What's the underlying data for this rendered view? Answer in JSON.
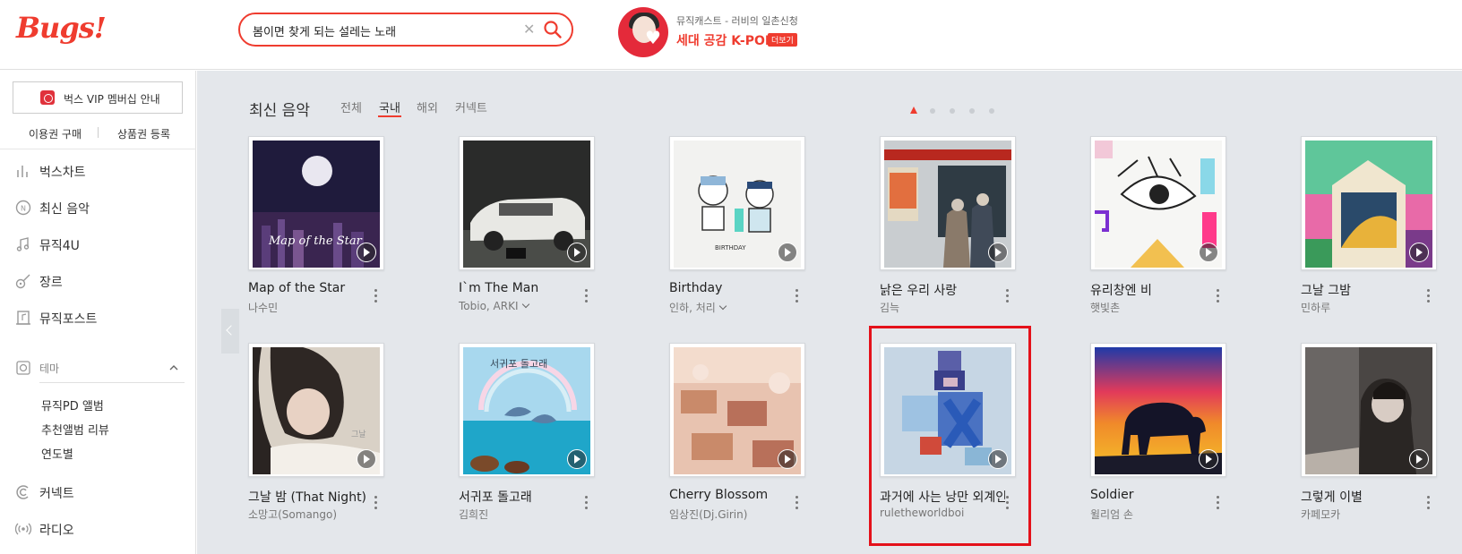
{
  "header": {
    "logo": "Bugs!",
    "search": {
      "value": "봄이면 찾게 되는 설레는 노래",
      "placeholder": ""
    },
    "promo": {
      "subtitle": "뮤직캐스트 - 러비의 일촌신청",
      "title": "세대 공감 K-POP",
      "more_label": "더보기"
    }
  },
  "sidebar": {
    "vip_label": "벅스 VIP 멤버십 안내",
    "buy_pass": "이용권 구매",
    "register_voucher": "상품권 등록",
    "nav": [
      {
        "label": "벅스차트",
        "icon": "chart-icon"
      },
      {
        "label": "최신 음악",
        "icon": "new-music-icon"
      },
      {
        "label": "뮤직4U",
        "icon": "music-note-icon"
      },
      {
        "label": "장르",
        "icon": "guitar-icon"
      },
      {
        "label": "뮤직포스트",
        "icon": "music-post-icon"
      }
    ],
    "theme": {
      "label": "테마",
      "items": [
        "뮤직PD 앨범",
        "추천앨범 리뷰",
        "연도별"
      ]
    },
    "nav_bottom": [
      {
        "label": "커넥트",
        "icon": "connect-icon"
      },
      {
        "label": "라디오",
        "icon": "radio-icon"
      }
    ]
  },
  "main": {
    "section_title": "최신 음악",
    "tabs": [
      "전체",
      "국내",
      "해외",
      "커넥트"
    ],
    "active_tab": "국내",
    "page_dots": 5,
    "albums": [
      {
        "title": "Map of the Star",
        "artist": "나수민",
        "has_dropdown": false
      },
      {
        "title": "I`m The Man",
        "artist": "Tobio, ARKI",
        "has_dropdown": true
      },
      {
        "title": "Birthday",
        "artist": "인하, 처리",
        "has_dropdown": true
      },
      {
        "title": "낡은 우리 사랑",
        "artist": "김늑",
        "has_dropdown": false
      },
      {
        "title": "유리창엔 비",
        "artist": "햇빛촌",
        "has_dropdown": false
      },
      {
        "title": "그날 그밤",
        "artist": "민하루",
        "has_dropdown": false
      },
      {
        "title": "그날 밤 (That Night)",
        "artist": "소망고(Somango)",
        "has_dropdown": false
      },
      {
        "title": "서귀포 돌고래",
        "artist": "김희진",
        "has_dropdown": false
      },
      {
        "title": "Cherry Blossom",
        "artist": "임상진(Dj.Girin)",
        "has_dropdown": false
      },
      {
        "title": "과거에 사는 낭만 외계인",
        "artist": "ruletheworldboi",
        "has_dropdown": false
      },
      {
        "title": "Soldier",
        "artist": "윌리엄 손",
        "has_dropdown": false
      },
      {
        "title": "그렇게 이별",
        "artist": "카페모카",
        "has_dropdown": false
      }
    ]
  },
  "colors": {
    "accent": "#ef3c2f",
    "highlight_box": "#e4111a",
    "main_bg": "#e4e7eb"
  }
}
